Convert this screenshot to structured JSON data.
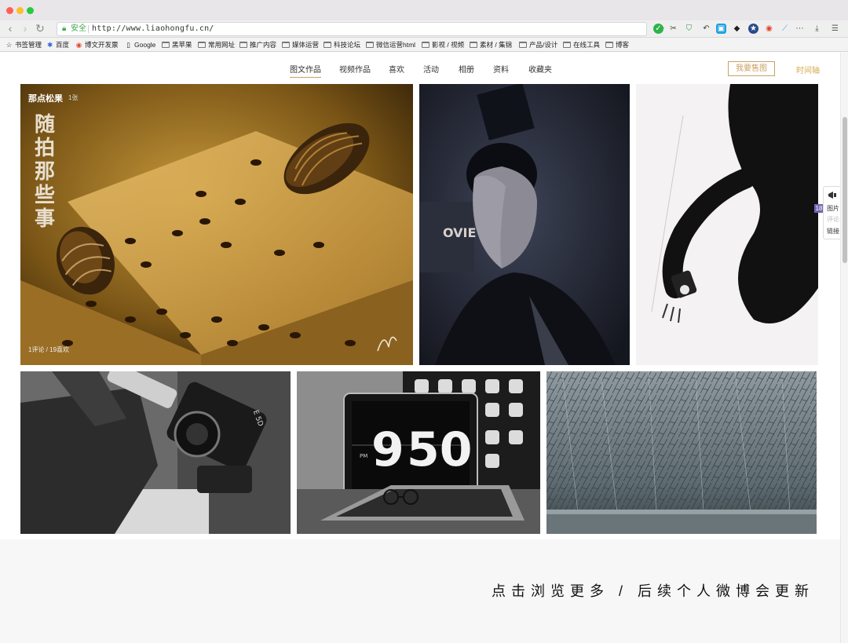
{
  "browser": {
    "security_label": "安全",
    "url": "http://www.liaohongfu.cn/"
  },
  "bookmarks": [
    {
      "label": "书签管理",
      "icon": "star-outline-icon"
    },
    {
      "label": "百度",
      "icon": "baidu-paw-icon"
    },
    {
      "label": "博文开发票",
      "icon": "weibo-icon"
    },
    {
      "label": "Google",
      "icon": "page-icon"
    },
    {
      "label": "黑苹果",
      "icon": "folder-icon"
    },
    {
      "label": "常用网址",
      "icon": "folder-icon"
    },
    {
      "label": "推广内容",
      "icon": "folder-icon"
    },
    {
      "label": "媒体运营",
      "icon": "folder-icon"
    },
    {
      "label": "科技论坛",
      "icon": "folder-icon"
    },
    {
      "label": "微信运营html",
      "icon": "folder-icon"
    },
    {
      "label": "影视 / 视频",
      "icon": "folder-icon"
    },
    {
      "label": "素材 / 集锦",
      "icon": "folder-icon"
    },
    {
      "label": "产品/设计",
      "icon": "folder-icon"
    },
    {
      "label": "在线工具",
      "icon": "folder-icon"
    },
    {
      "label": "博客",
      "icon": "folder-icon"
    }
  ],
  "site_nav": {
    "items": [
      "图文作品",
      "视频作品",
      "喜欢",
      "活动",
      "相册",
      "资料",
      "收藏夹"
    ],
    "active_index": 0,
    "buy_button": "我要售图",
    "timeline_link": "时间轴"
  },
  "gallery": {
    "cover": {
      "title": "那点松果",
      "count": "1张",
      "stats": "1评论 / 19喜欢",
      "overlay_text": "随拍那些事"
    },
    "photos": [
      {
        "name": "pinecone-photo"
      },
      {
        "name": "portrait-photo"
      },
      {
        "name": "upside-down-figure-photo"
      },
      {
        "name": "camera-bag-photo"
      },
      {
        "name": "clock-desk-photo",
        "clock_hour": "9",
        "clock_min": "50",
        "clock_pm": "PM"
      },
      {
        "name": "forest-photo"
      }
    ]
  },
  "side_widget": {
    "badge": "18",
    "line1": "图片",
    "line2": "评论",
    "line3": "链接"
  },
  "footer": {
    "text": "点击浏览更多 / 后续个人微博会更新"
  },
  "colors": {
    "accent": "#c9a063",
    "timeline": "#d8a94b"
  }
}
